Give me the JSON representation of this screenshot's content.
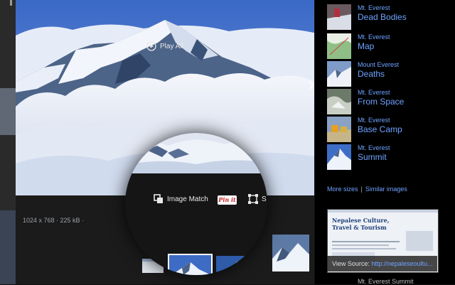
{
  "main_image": {
    "dimensions": "1024 x 768 · 225 kB ·"
  },
  "toolbar": {
    "image_match_label": "Image Match",
    "pinit_label": "Pin it",
    "s_label": "S",
    "play_all_label": "Play All"
  },
  "related": [
    {
      "top": "Mt. Everest",
      "bottom": "Dead Bodies"
    },
    {
      "top": "Mt. Everest",
      "bottom": "Map"
    },
    {
      "top": "Mount Everest",
      "bottom": "Deaths"
    },
    {
      "top": "Mt. Everest",
      "bottom": "From Space"
    },
    {
      "top": "Mt. Everest",
      "bottom": "Base Camp"
    },
    {
      "top": "Mt. Everest",
      "bottom": "Summit"
    }
  ],
  "links": {
    "more_sizes": "More sizes",
    "separator": "|",
    "similar_images": "Similar images"
  },
  "source": {
    "preview_title": "Nepalese Culture, Travel & Tourism",
    "view_label": "View Source:",
    "url": "http://nepaleseoultu..."
  },
  "bottom_caption": "Mt. Everest Summit",
  "colors": {
    "link": "#6fa3ff",
    "panel_bg": "#000000",
    "pinit_red": "#cb2027"
  },
  "icons": [
    "chevron-right-icon",
    "image-match-icon",
    "crop-icon",
    "play-icon"
  ]
}
